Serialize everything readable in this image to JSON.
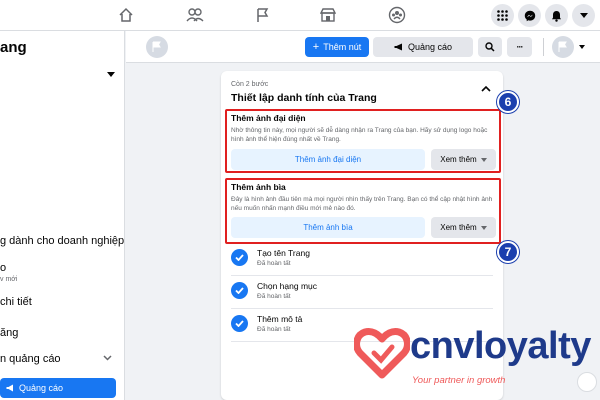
{
  "topnav": {
    "icons": [
      "home-icon",
      "friends-icon",
      "pages-flag-icon",
      "marketplace-icon",
      "groups-icon",
      "menu-grid-icon",
      "messenger-icon",
      "notifications-icon",
      "account-caret-icon"
    ]
  },
  "sidebar": {
    "page_name": "ang",
    "items": [
      {
        "label": "g dành cho doanh nghiệp"
      },
      {
        "label": "o",
        "sub": "v mới"
      },
      {
        "label": "chi tiết"
      },
      {
        "label": "ăng"
      },
      {
        "label": "n quảng cáo"
      }
    ],
    "ad_button": "Quảng cáo"
  },
  "header": {
    "add_button": "Thêm nút",
    "ad_button": "Quảng cáo",
    "more_label": "···"
  },
  "card": {
    "steps_left": "Còn 2 bước",
    "title": "Thiết lập danh tính của Trang",
    "profile": {
      "title": "Thêm ảnh đại diện",
      "desc": "Nhờ thông tin này, mọi người sẽ dễ dàng nhận ra Trang của bạn. Hãy sử dụng logo hoặc hình ảnh thể hiện đúng nhất về Trang.",
      "button": "Thêm ảnh đại diện",
      "more": "Xem thêm",
      "badge": "6"
    },
    "cover": {
      "title": "Thêm ảnh bìa",
      "desc": "Đây là hình ảnh đầu tiên mà mọi người nhìn thấy trên Trang. Bạn có thể cập nhật hình ảnh nếu muốn nhấn mạnh điều mới mẻ nào đó.",
      "button": "Thêm ảnh bìa",
      "more": "Xem thêm",
      "badge": "7"
    },
    "completed": [
      {
        "title": "Tạo tên Trang",
        "status": "Đã hoàn tất"
      },
      {
        "title": "Chọn hạng mục",
        "status": "Đã hoàn tất"
      },
      {
        "title": "Thêm mô tả",
        "status": "Đã hoàn tất"
      }
    ]
  },
  "watermark": {
    "brand": "cnvloyalty",
    "tagline": "Your partner in growth"
  },
  "colors": {
    "fb_blue": "#1877f2",
    "light_blue": "#e7f3ff",
    "annotation_red": "#e02020",
    "badge_navy": "#1b3fae",
    "brand_navy": "#1e3a8a",
    "brand_pink": "#ef5a5a"
  }
}
